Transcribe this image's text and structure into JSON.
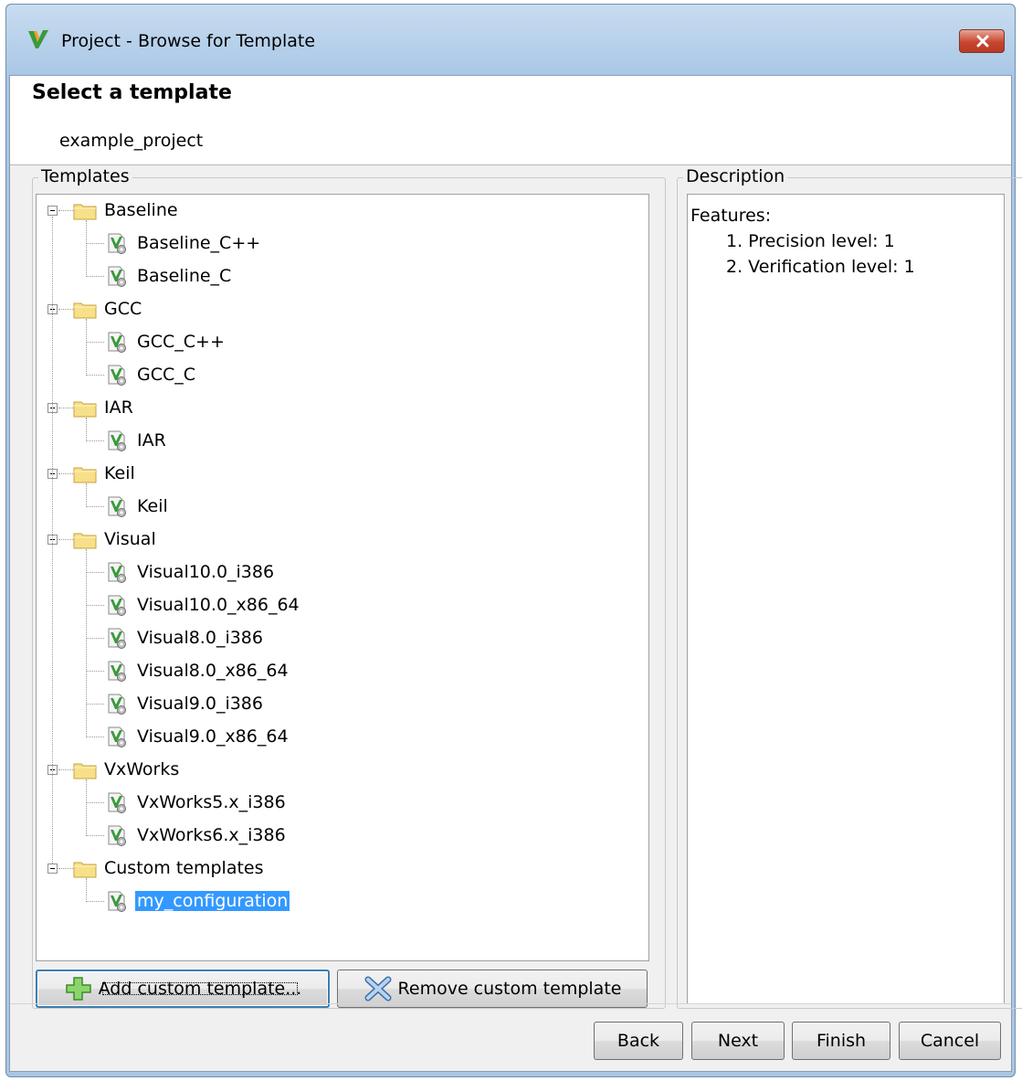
{
  "window": {
    "title": "Project - Browse for Template",
    "heading": "Select a template",
    "project_name": "example_project"
  },
  "templates": {
    "legend": "Templates",
    "groups": [
      {
        "label": "Baseline",
        "items": [
          "Baseline_C++",
          "Baseline_C"
        ]
      },
      {
        "label": "GCC",
        "items": [
          "GCC_C++",
          "GCC_C"
        ]
      },
      {
        "label": "IAR",
        "items": [
          "IAR"
        ]
      },
      {
        "label": "Keil",
        "items": [
          "Keil"
        ]
      },
      {
        "label": "Visual",
        "items": [
          "Visual10.0_i386",
          "Visual10.0_x86_64",
          "Visual8.0_i386",
          "Visual8.0_x86_64",
          "Visual9.0_i386",
          "Visual9.0_x86_64"
        ]
      },
      {
        "label": "VxWorks",
        "items": [
          "VxWorks5.x_i386",
          "VxWorks6.x_i386"
        ]
      },
      {
        "label": "Custom templates",
        "items": [
          "my_configuration"
        ]
      }
    ],
    "selected": "my_configuration",
    "add_button": "Add custom template...",
    "remove_button": "Remove custom template"
  },
  "description": {
    "legend": "Description",
    "heading": "Features:",
    "lines": [
      "1. Precision level: 1",
      "2. Verification level: 1"
    ]
  },
  "footer": {
    "back": "Back",
    "next": "Next",
    "finish": "Finish",
    "cancel": "Cancel"
  },
  "colors": {
    "selection": "#3399ff",
    "title_bar": "#a9c6e3",
    "close_button": "#c8452f"
  }
}
